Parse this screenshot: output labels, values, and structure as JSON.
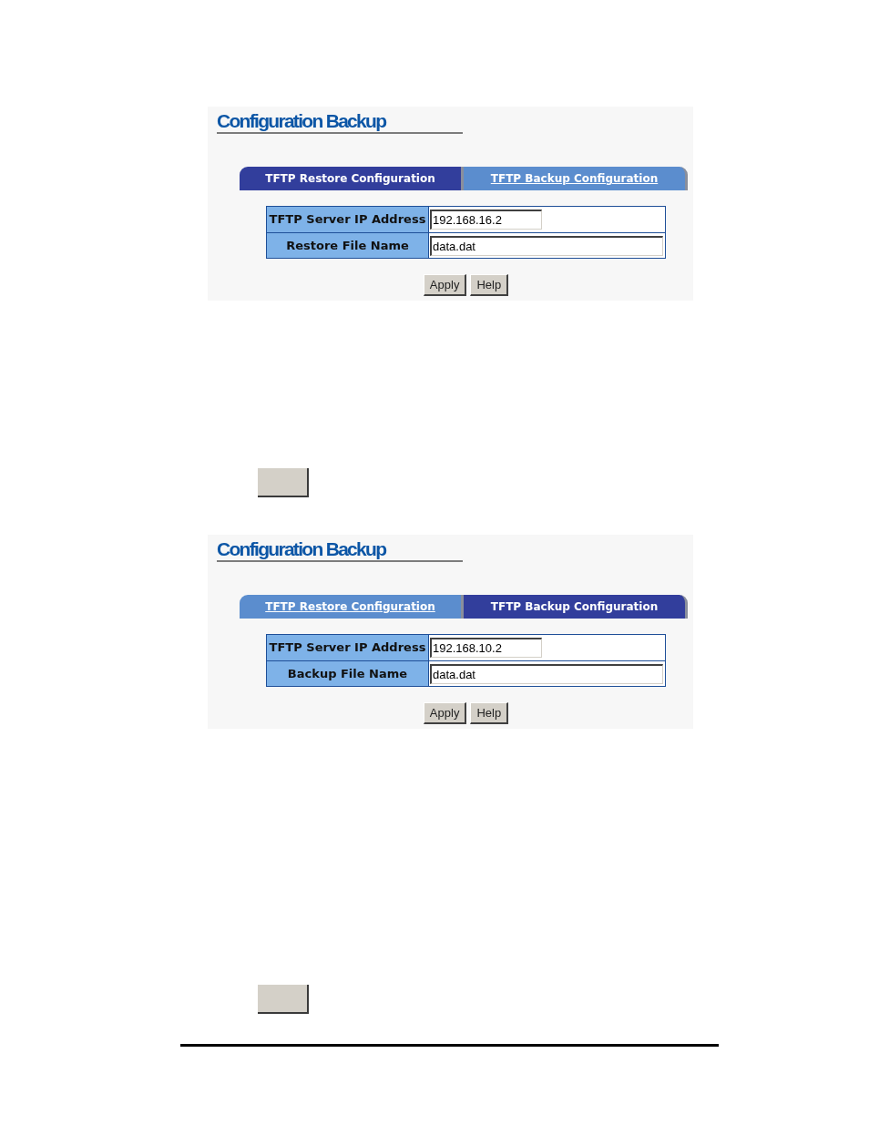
{
  "sections": [
    {
      "title": "Configuration Backup",
      "tabs": [
        {
          "label": "TFTP Restore Configuration",
          "selected": true
        },
        {
          "label": "TFTP Backup Configuration",
          "selected": false
        }
      ],
      "fields": [
        {
          "kind": "short",
          "label": "TFTP Server IP Address",
          "value": "192.168.16.2"
        },
        {
          "kind": "long",
          "label": "Restore File Name",
          "value": "data.dat"
        }
      ],
      "buttons": [
        "Apply",
        "Help"
      ]
    },
    {
      "title": "Configuration Backup",
      "tabs": [
        {
          "label": "TFTP Restore Configuration",
          "selected": false
        },
        {
          "label": "TFTP Backup Configuration",
          "selected": true
        }
      ],
      "fields": [
        {
          "kind": "short",
          "label": "TFTP Server IP Address",
          "value": "192.168.10.2"
        },
        {
          "kind": "long",
          "label": "Backup File Name",
          "value": "data.dat"
        }
      ],
      "buttons": [
        "Apply",
        "Help"
      ]
    }
  ]
}
